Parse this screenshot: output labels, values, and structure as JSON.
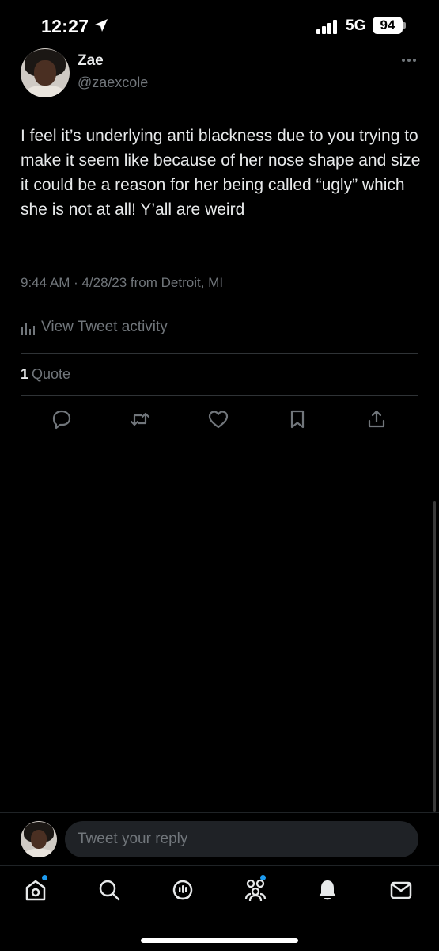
{
  "status_bar": {
    "time": "12:27",
    "network": "5G",
    "battery": "94"
  },
  "tweet": {
    "author_name": "Zae",
    "author_handle": "@zaexcole",
    "text": "I feel it’s underlying anti blackness due to you trying to make it seem like because of her nose shape and size it could be a reason for her being called “ugly” which she is not at all! Y’all are weird",
    "timestamp": "9:44 AM · 4/28/23 from Detroit, MI",
    "activity_label": "View Tweet activity",
    "quote_count": "1",
    "quote_label": "Quote"
  },
  "actions": [
    {
      "icon": "reply-icon"
    },
    {
      "icon": "retweet-icon"
    },
    {
      "icon": "like-icon"
    },
    {
      "icon": "bookmark-icon"
    },
    {
      "icon": "share-icon"
    }
  ],
  "reply": {
    "placeholder": "Tweet your reply"
  },
  "nav": [
    {
      "icon": "home-icon",
      "notification_dot": true
    },
    {
      "icon": "search-icon",
      "notification_dot": false
    },
    {
      "icon": "spaces-icon",
      "notification_dot": false
    },
    {
      "icon": "communities-icon",
      "notification_dot": true
    },
    {
      "icon": "notifications-icon",
      "notification_dot": false
    },
    {
      "icon": "messages-icon",
      "notification_dot": false
    }
  ],
  "colors": {
    "background": "#000000",
    "primary_text": "#e7e9ea",
    "secondary_text": "#71767b",
    "divider": "#2f3336",
    "accent": "#1d9bf0"
  }
}
